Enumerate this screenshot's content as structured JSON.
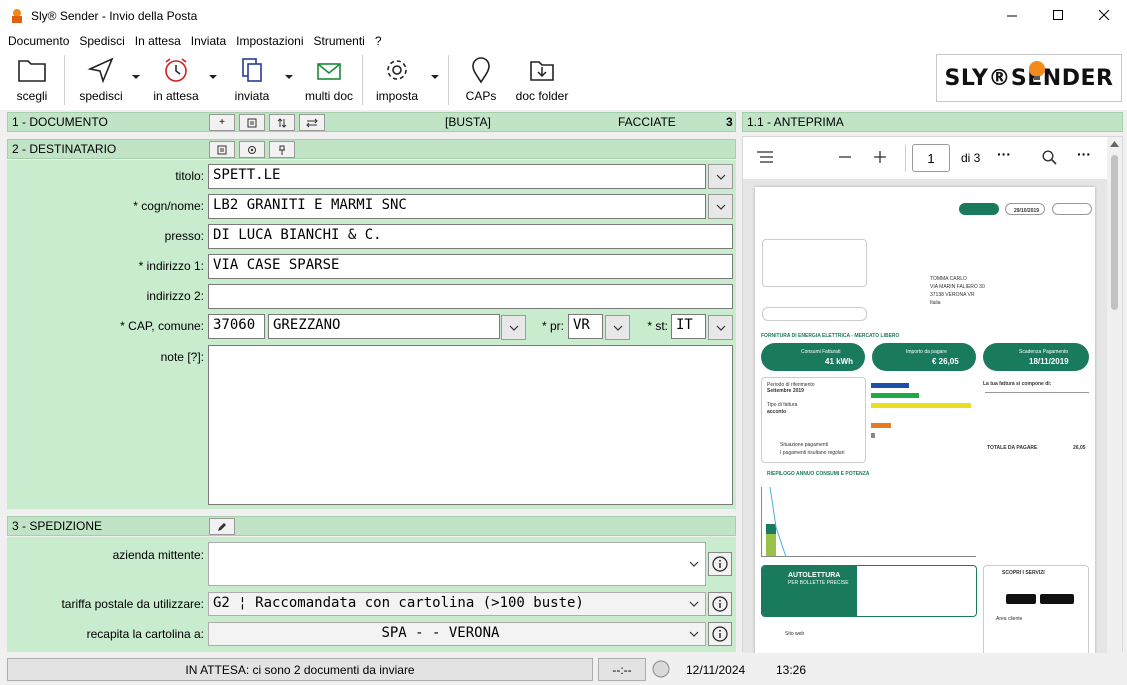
{
  "window": {
    "title": "Sly® Sender - Invio della Posta"
  },
  "menu": [
    "Documento",
    "Spedisci",
    "In attesa",
    "Inviata",
    "Impostazioni",
    "Strumenti",
    "?"
  ],
  "toolbar": {
    "scegli": "scegli",
    "spedisci": "spedisci",
    "in_attesa": "in attesa",
    "inviata": "inviata",
    "multi_doc": "multi doc",
    "imposta": "imposta",
    "caps": "CAPs",
    "doc_folder": "doc folder"
  },
  "logo": {
    "text": "SLY®SENDER"
  },
  "documento": {
    "header": "1 - DOCUMENTO",
    "busta": "[BUSTA]",
    "facciate_label": "FACCIATE",
    "facciate_value": "3"
  },
  "anteprima": {
    "header": "1.1 - ANTEPRIMA",
    "page_number": "1",
    "page_total": "di 3"
  },
  "destinatario": {
    "header": "2 - DESTINATARIO",
    "labels": {
      "titolo": "titolo:",
      "cognome": "* cogn/nome:",
      "presso": "presso:",
      "indirizzo1": "* indirizzo 1:",
      "indirizzo2": "indirizzo 2:",
      "cap_comune": "* CAP, comune:",
      "pr": "* pr:",
      "st": "* st:",
      "note": "note [?]:"
    },
    "values": {
      "titolo": "SPETT.LE",
      "cognome": "LB2 GRANITI E MARMI SNC",
      "presso": "DI LUCA BIANCHI & C.",
      "indirizzo1": "VIA CASE SPARSE",
      "indirizzo2": "",
      "cap": "37060",
      "comune": "GREZZANO",
      "pr": "VR",
      "st": "IT",
      "note": ""
    }
  },
  "spedizione": {
    "header": "3 - SPEDIZIONE",
    "labels": {
      "azienda": "azienda mittente:",
      "tariffa": "tariffa postale da utilizzare:",
      "recapita": "recapita la cartolina a:"
    },
    "values": {
      "tariffa": "G2 ¦ Raccomandata con cartolina (>100 buste)",
      "recapita": "SPA -  - VERONA"
    }
  },
  "preview_doc": {
    "recipient_name": "TOMMA CARLO",
    "recipient_street": "VIA MARIN FALIERO 30",
    "recipient_city": "37138 VERONA VR",
    "recipient_country": "Italia",
    "header_date": "29/10/2019",
    "section_title": "FORNITURA DI ENERGIA ELETTRICA - MERCATO LIBERO",
    "consumi_label": "Consumi Fatturati",
    "consumi_value": "41 kWh",
    "importo_label": "Importo da pagare",
    "importo_value": "€ 26,05",
    "scadenza_label": "Scadenza Pagamento",
    "scadenza_value": "18/11/2019",
    "periodo_label": "Periodo di riferimento",
    "periodo_value": "Settembre 2019",
    "tipo_label": "Tipo di fattura",
    "tipo_value": "acconto",
    "situazione_label": "Situazione pagamenti",
    "situazione_value": "I pagamenti risultano regolari",
    "composizione_title": "La tua fattura si compone di:",
    "riepilogo_title": "RIEPILOGO ANNUO CONSUMI E POTENZA",
    "autolettura_title": "AUTOLETTURA",
    "autolettura_sub": "PER BOLLETTE PRECISE",
    "servizi_title": "SCOPRI I SERVIZI",
    "sito_web": "Sito web",
    "area_cliente": "Area cliente",
    "totale_label": "TOTALE DA PAGARE",
    "totale_value": "26,05"
  },
  "status": {
    "message": "IN ATTESA: ci sono 2 documenti da inviare",
    "timer": "--:--",
    "date": "12/11/2024",
    "time": "13:26"
  }
}
